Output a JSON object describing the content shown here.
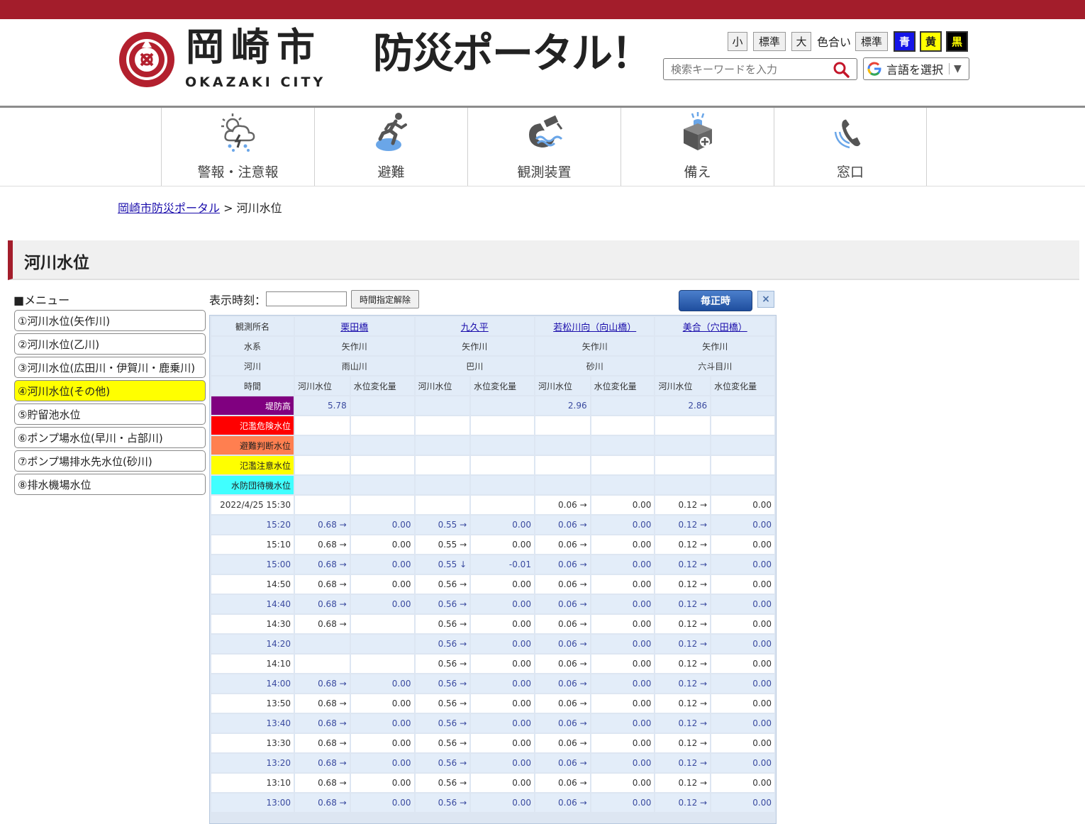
{
  "header": {
    "city_jp": "岡崎市",
    "city_en": "OKAZAKI CITY",
    "portal_title": "防災ポータル！",
    "font_size_buttons": [
      "小",
      "標準",
      "大"
    ],
    "color_label": "色合い",
    "color_buttons": [
      "標準",
      "青",
      "黄",
      "黒"
    ],
    "search_placeholder": "検索キーワードを入力",
    "language_label": "言語を選択",
    "colors": {
      "brand": "#a31d2b",
      "blue": "#1515e8",
      "yellow": "#ffff00",
      "black": "#000000"
    }
  },
  "nav": [
    {
      "label": "警報・注意報",
      "icon": "weather-storm-icon"
    },
    {
      "label": "避難",
      "icon": "running-person-icon"
    },
    {
      "label": "観測装置",
      "icon": "camera-wave-icon"
    },
    {
      "label": "備え",
      "icon": "emergency-kit-icon"
    },
    {
      "label": "窓口",
      "icon": "phone-icon"
    }
  ],
  "breadcrumb": {
    "home": "岡崎市防災ポータル",
    "separator": ">",
    "current": "河川水位"
  },
  "page_title": "河川水位",
  "menu": {
    "title": "■メニュー",
    "items": [
      "①河川水位(矢作川)",
      "②河川水位(乙川)",
      "③河川水位(広田川・伊賀川・鹿乗川)",
      "④河川水位(その他)",
      "⑤貯留池水位",
      "⑥ポンプ場水位(早川・占部川)",
      "⑦ポンプ場排水先水位(砂川)",
      "⑧排水機場水位"
    ],
    "active_index": 3
  },
  "controls": {
    "time_label": "表示時刻：",
    "time_value": "",
    "clear_button": "時間指定解除",
    "hourly_button": "毎正時",
    "close_button": "×"
  },
  "table": {
    "row_labels": {
      "station": "観測所名",
      "system": "水系",
      "river": "河川",
      "time": "時間"
    },
    "stations": [
      {
        "name": "栗田橋",
        "system": "矢作川",
        "river": "雨山川"
      },
      {
        "name": "九久平",
        "system": "矢作川",
        "river": "巴川"
      },
      {
        "name": "若松川向（向山橋）",
        "system": "矢作川",
        "river": "砂川"
      },
      {
        "name": "美合（穴田橋）",
        "system": "矢作川",
        "river": "六斗目川"
      }
    ],
    "sub_headers": [
      "河川水位",
      "水位変化量"
    ],
    "levels": [
      {
        "label": "堤防高",
        "values": [
          "5.78",
          "",
          "",
          "",
          "2.96",
          "",
          "2.86",
          ""
        ]
      },
      {
        "label": "氾濫危険水位",
        "values": [
          "",
          "",
          "",
          "",
          "",
          "",
          "",
          ""
        ]
      },
      {
        "label": "避難判断水位",
        "values": [
          "",
          "",
          "",
          "",
          "",
          "",
          "",
          ""
        ]
      },
      {
        "label": "氾濫注意水位",
        "values": [
          "",
          "",
          "",
          "",
          "",
          "",
          "",
          ""
        ]
      },
      {
        "label": "水防団待機水位",
        "values": [
          "",
          "",
          "",
          "",
          "",
          "",
          "",
          ""
        ]
      }
    ],
    "rows": [
      {
        "time": "2022/4/25 15:30",
        "values": [
          "",
          "",
          "",
          "",
          "0.06 →",
          "0.00",
          "0.12 →",
          "0.00"
        ]
      },
      {
        "time": "15:20",
        "values": [
          "0.68 →",
          "0.00",
          "0.55 →",
          "0.00",
          "0.06 →",
          "0.00",
          "0.12 →",
          "0.00"
        ]
      },
      {
        "time": "15:10",
        "values": [
          "0.68 →",
          "0.00",
          "0.55 →",
          "0.00",
          "0.06 →",
          "0.00",
          "0.12 →",
          "0.00"
        ]
      },
      {
        "time": "15:00",
        "values": [
          "0.68 →",
          "0.00",
          "0.55 ↓",
          "-0.01",
          "0.06 →",
          "0.00",
          "0.12 →",
          "0.00"
        ]
      },
      {
        "time": "14:50",
        "values": [
          "0.68 →",
          "0.00",
          "0.56 →",
          "0.00",
          "0.06 →",
          "0.00",
          "0.12 →",
          "0.00"
        ]
      },
      {
        "time": "14:40",
        "values": [
          "0.68 →",
          "0.00",
          "0.56 →",
          "0.00",
          "0.06 →",
          "0.00",
          "0.12 →",
          "0.00"
        ]
      },
      {
        "time": "14:30",
        "values": [
          "0.68 →",
          "",
          "0.56 →",
          "0.00",
          "0.06 →",
          "0.00",
          "0.12 →",
          "0.00"
        ]
      },
      {
        "time": "14:20",
        "values": [
          "",
          "",
          "0.56 →",
          "0.00",
          "0.06 →",
          "0.00",
          "0.12 →",
          "0.00"
        ]
      },
      {
        "time": "14:10",
        "values": [
          "",
          "",
          "0.56 →",
          "0.00",
          "0.06 →",
          "0.00",
          "0.12 →",
          "0.00"
        ]
      },
      {
        "time": "14:00",
        "values": [
          "0.68 →",
          "0.00",
          "0.56 →",
          "0.00",
          "0.06 →",
          "0.00",
          "0.12 →",
          "0.00"
        ]
      },
      {
        "time": "13:50",
        "values": [
          "0.68 →",
          "0.00",
          "0.56 →",
          "0.00",
          "0.06 →",
          "0.00",
          "0.12 →",
          "0.00"
        ]
      },
      {
        "time": "13:40",
        "values": [
          "0.68 →",
          "0.00",
          "0.56 →",
          "0.00",
          "0.06 →",
          "0.00",
          "0.12 →",
          "0.00"
        ]
      },
      {
        "time": "13:30",
        "values": [
          "0.68 →",
          "0.00",
          "0.56 →",
          "0.00",
          "0.06 →",
          "0.00",
          "0.12 →",
          "0.00"
        ]
      },
      {
        "time": "13:20",
        "values": [
          "0.68 →",
          "0.00",
          "0.56 →",
          "0.00",
          "0.06 →",
          "0.00",
          "0.12 →",
          "0.00"
        ]
      },
      {
        "time": "13:10",
        "values": [
          "0.68 →",
          "0.00",
          "0.56 →",
          "0.00",
          "0.06 →",
          "0.00",
          "0.12 →",
          "0.00"
        ]
      },
      {
        "time": "13:00",
        "values": [
          "0.68 →",
          "0.00",
          "0.56 →",
          "0.00",
          "0.06 →",
          "0.00",
          "0.12 →",
          "0.00"
        ]
      }
    ]
  }
}
